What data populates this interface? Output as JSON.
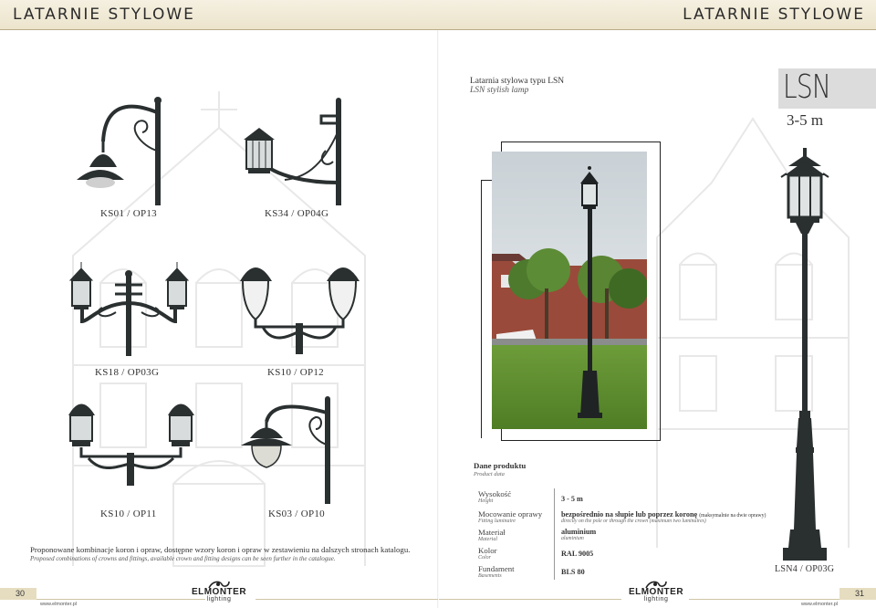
{
  "header": {
    "left_title": "Latarnie stylowe",
    "right_title": "Latarnie stylowe"
  },
  "left_page": {
    "captions": [
      "KS01 / OP13",
      "KS34 / OP04G",
      "KS18 / OP03G",
      "KS10 / OP12",
      "KS10 / OP11",
      "KS03 / OP10"
    ],
    "note_pl": "Proponowane kombinacje koron i opraw, dostępne wzory koron i opraw w zestawieniu na dalszych stronach katalogu.",
    "note_en": "Proposed combinations of crowns and fittings, available crown and fitting designs can be seen further in the catalogue.",
    "page_number": "30",
    "website": "www.elmonter.pl"
  },
  "right_page": {
    "lamp_type_pl": "Latarnia stylowa typu LSN",
    "lamp_type_en": "LSN stylish lamp",
    "model_name": "LSN",
    "model_height": "3-5 m",
    "product_data_pl": "Dane produktu",
    "product_data_en": "Product data",
    "specs": [
      {
        "label_pl": "Wysokość",
        "label_en": "Height",
        "value": "3 - 5 m",
        "value_note": "",
        "value_en": ""
      },
      {
        "label_pl": "Mocowanie oprawy",
        "label_en": "Fitting luminaire",
        "value": "bezpośrednio na słupie lub poprzez koronę",
        "value_note": "(maksymalnie na dwie oprawy)",
        "value_en": "directly on the pole or through the crown (maximum two luminaires)"
      },
      {
        "label_pl": "Materiał",
        "label_en": "Material",
        "value": "aluminium",
        "value_note": "",
        "value_en": "aluminium"
      },
      {
        "label_pl": "Kolor",
        "label_en": "Color",
        "value": "RAL 9005",
        "value_note": "",
        "value_en": ""
      },
      {
        "label_pl": "Fundament",
        "label_en": "Basements",
        "value": "BLS 80",
        "value_note": "",
        "value_en": ""
      }
    ],
    "lamp_caption": "LSN4 / OP03G",
    "page_number": "31",
    "website": "www.elmonter.pl"
  },
  "logo": {
    "name": "ELMONTER",
    "sub": "lighting"
  },
  "colors": {
    "header_bg": "#ece4cc",
    "lamp_fill": "#2a2f30",
    "model_box": "#dcdcdc"
  }
}
